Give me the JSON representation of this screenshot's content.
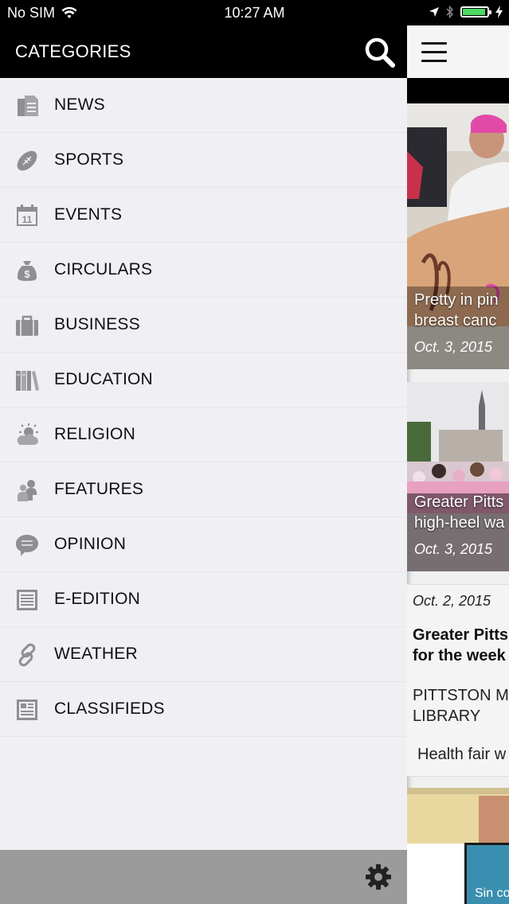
{
  "status_bar": {
    "carrier": "No SIM",
    "time": "10:27 AM"
  },
  "drawer": {
    "title": "CATEGORIES",
    "items": [
      {
        "label": "NEWS",
        "icon": "newspaper-icon"
      },
      {
        "label": "SPORTS",
        "icon": "football-icon"
      },
      {
        "label": "EVENTS",
        "icon": "calendar-icon"
      },
      {
        "label": "CIRCULARS",
        "icon": "money-bag-icon"
      },
      {
        "label": "BUSINESS",
        "icon": "briefcase-icon"
      },
      {
        "label": "EDUCATION",
        "icon": "books-icon"
      },
      {
        "label": "RELIGION",
        "icon": "sun-cloud-icon"
      },
      {
        "label": "FEATURES",
        "icon": "people-icon"
      },
      {
        "label": "OPINION",
        "icon": "speech-bubble-icon"
      },
      {
        "label": "E-EDITION",
        "icon": "document-icon"
      },
      {
        "label": "WEATHER",
        "icon": "link-icon"
      },
      {
        "label": "CLASSIFIEDS",
        "icon": "classified-icon"
      }
    ]
  },
  "content": {
    "cards": [
      {
        "title_line1": "Pretty in pin",
        "title_line2": "breast canc",
        "date": "Oct. 3, 2015"
      },
      {
        "title_line1": "Greater Pitts",
        "title_line2": "high-heel wa",
        "date": "Oct. 3, 2015"
      }
    ],
    "text_card": {
      "date": "Oct. 2, 2015",
      "title_line1": "Greater Pitts",
      "title_line2": "for the week",
      "sub_line1": "PITTSTON M",
      "sub_line2": "LIBRARY",
      "body": "Health fair w"
    },
    "ad_text": "Sin co"
  },
  "colors": {
    "drawer_bg": "#efeff4",
    "header_bg": "#000000",
    "footer_bg": "#9b9b9b",
    "icon_gray": "#8e8e93",
    "battery_green": "#4cd964"
  }
}
